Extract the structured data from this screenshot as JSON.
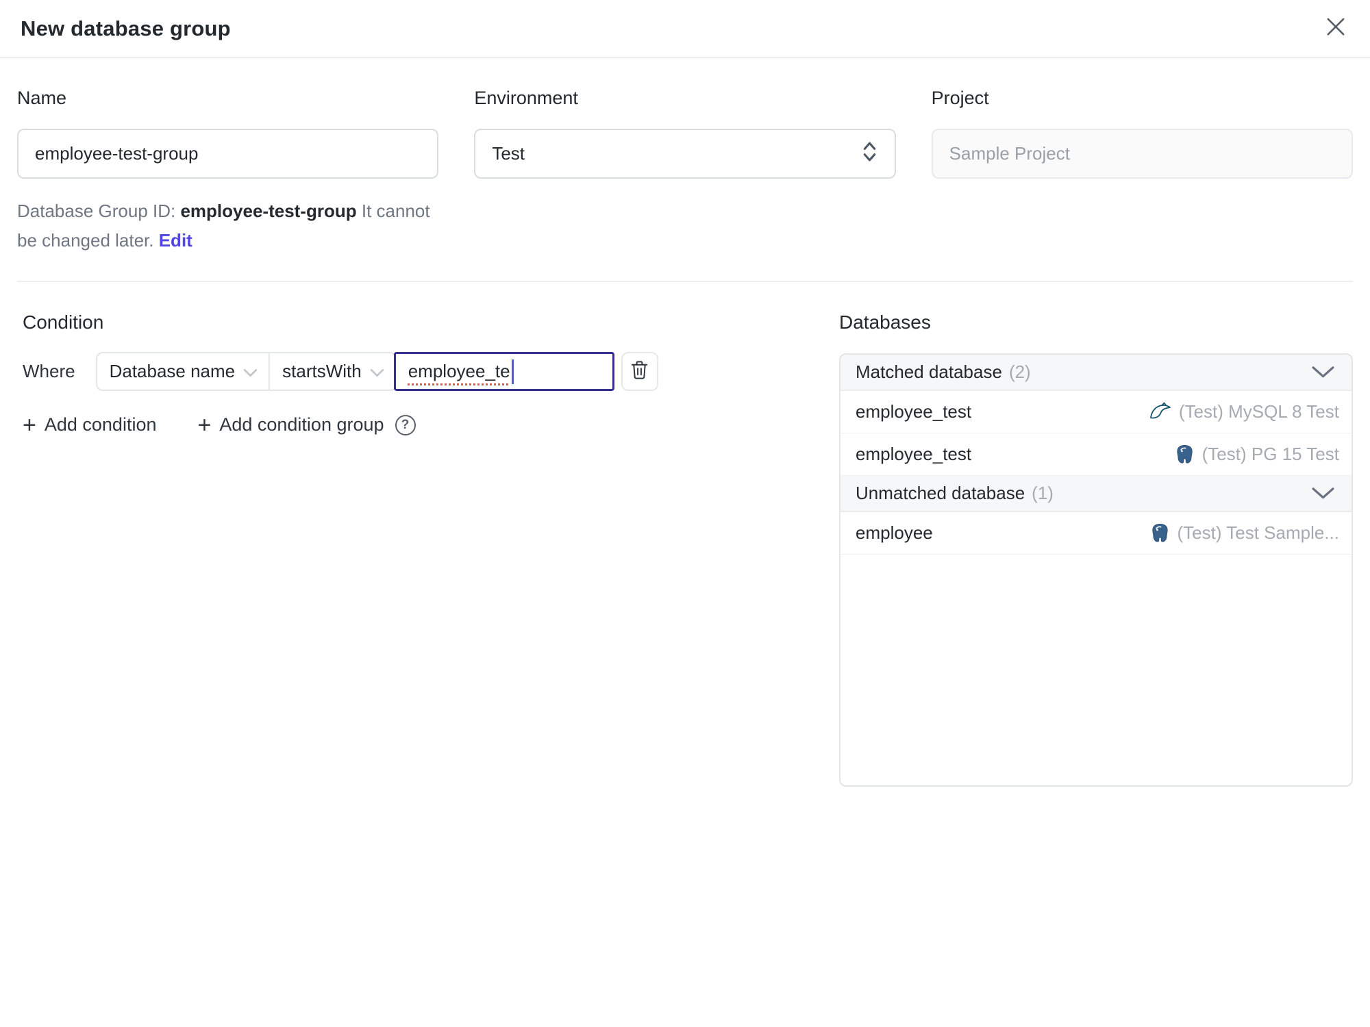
{
  "header": {
    "title": "New database group"
  },
  "form": {
    "name": {
      "label": "Name",
      "value": "employee-test-group"
    },
    "environment": {
      "label": "Environment",
      "value": "Test"
    },
    "project": {
      "label": "Project",
      "value": "Sample Project"
    },
    "group_id_help": {
      "prefix": "Database Group ID: ",
      "id": "employee-test-group",
      "suffix": " It cannot be changed later. ",
      "edit_label": "Edit"
    }
  },
  "condition": {
    "heading": "Condition",
    "where_label": "Where",
    "field_select": "Database name",
    "operator_select": "startsWith",
    "value_input": "employee_te",
    "add_condition_label": "Add condition",
    "add_condition_group_label": "Add condition group"
  },
  "databases": {
    "heading": "Databases",
    "sections": [
      {
        "title": "Matched database",
        "count": "(2)",
        "rows": [
          {
            "name": "employee_test",
            "engine": "mysql",
            "instance": "(Test) MySQL 8 Test"
          },
          {
            "name": "employee_test",
            "engine": "postgres",
            "instance": "(Test) PG 15 Test"
          }
        ]
      },
      {
        "title": "Unmatched database",
        "count": "(1)",
        "rows": [
          {
            "name": "employee",
            "engine": "postgres",
            "instance": "(Test) Test Sample..."
          }
        ]
      }
    ]
  },
  "icons": {
    "plus": "+",
    "help": "?"
  },
  "colors": {
    "link_accent": "#4f46e5",
    "focused_border": "#35308c",
    "spellcheck_red": "#e4594f",
    "mysql_blue": "#14536e",
    "postgres_blue": "#38628c",
    "muted_text": "#a6abb2",
    "section_header_bg": "#f6f7f8"
  }
}
